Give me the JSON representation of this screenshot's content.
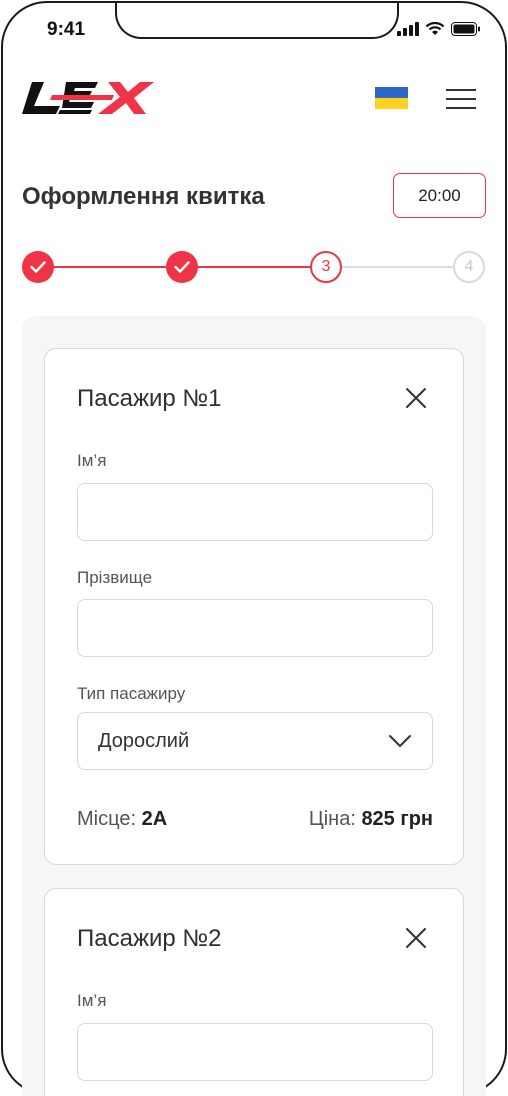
{
  "status_bar": {
    "time": "9:41"
  },
  "header": {
    "logo_text": "LEX",
    "language_flag": "ua-flag",
    "menu_icon": "hamburger-menu-icon"
  },
  "page": {
    "title": "Оформлення квитка",
    "timer": "20:00"
  },
  "stepper": {
    "steps": [
      {
        "label": "",
        "state": "done"
      },
      {
        "label": "",
        "state": "done"
      },
      {
        "label": "3",
        "state": "current"
      },
      {
        "label": "4",
        "state": "future"
      }
    ]
  },
  "colors": {
    "accent": "#ef3447",
    "panel_bg": "#f6f6f6",
    "border": "#d8d8d8",
    "flag_blue": "#2f67c9",
    "flag_yellow": "#ffd21f"
  },
  "passengers": [
    {
      "title": "Пасажир №1",
      "first_name_label": "Ім’я",
      "first_name_value": "",
      "last_name_label": "Прізвище",
      "last_name_value": "",
      "type_label": "Тип пасажиру",
      "type_value": "Дорослий",
      "seat_label": "Місце:",
      "seat_value": "2A",
      "price_label": "Ціна:",
      "price_value": "825 грн"
    },
    {
      "title": "Пасажир №2",
      "first_name_label": "Ім’я",
      "first_name_value": ""
    }
  ]
}
